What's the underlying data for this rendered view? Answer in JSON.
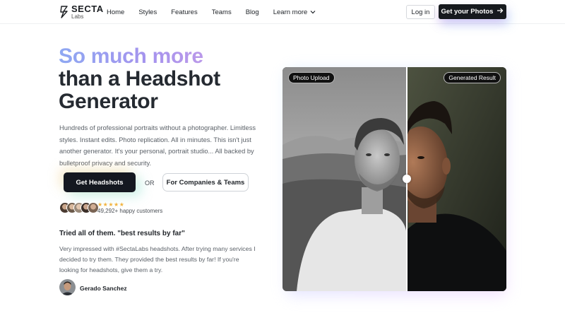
{
  "brand": {
    "name": "SECTA",
    "sub": "Labs"
  },
  "nav": {
    "links": [
      "Home",
      "Styles",
      "Features",
      "Teams",
      "Blog"
    ],
    "more": "Learn more",
    "login": "Log in",
    "cta": "Get your Photos"
  },
  "hero": {
    "headline_accent": "So much more",
    "headline_line2": "than a Headshot",
    "headline_line3": "Generator",
    "description": "Hundreds of professional portraits without a photographer. Limitless styles. Instant edits. Photo replication. All in minutes. This isn't just another generator. It's your personal, portrait studio... All backed by bulletproof privacy and security.",
    "primary_button": "Get Headshots",
    "or": "OR",
    "secondary_button": "For Companies & Teams",
    "stars": "★★★★★",
    "customers": "49,292+ happy customers"
  },
  "testimonial": {
    "title": "Tried all of them. \"best results by far\"",
    "body": "Very impressed with #SectaLabs headshots. After trying many services I decided to try them. They provided the best results by far! If you're looking for headshots, give them a try.",
    "author": "Gerado Sanchez"
  },
  "comparison": {
    "left_label": "Photo Upload",
    "right_label": "Generated Result"
  },
  "colors": {
    "dark": "#16191e",
    "accent_gradient_start": "#8ea8f2",
    "accent_gradient_end": "#c19be8",
    "star": "#f2b33d"
  }
}
